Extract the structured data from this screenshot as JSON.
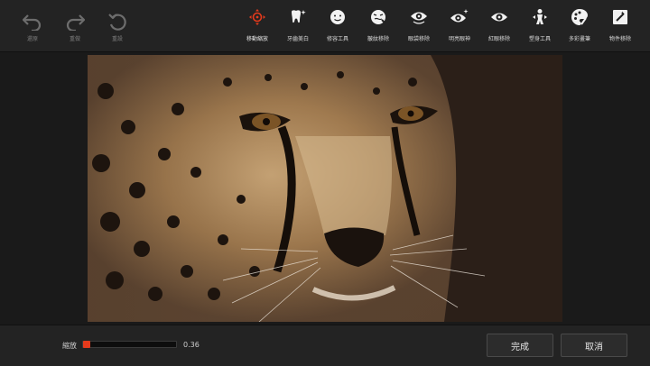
{
  "history": [
    {
      "name": "undo",
      "label": "還原",
      "icon": "undo-icon"
    },
    {
      "name": "redo",
      "label": "重做",
      "icon": "redo-icon"
    },
    {
      "name": "reset",
      "label": "重設",
      "icon": "reset-icon"
    }
  ],
  "tools": [
    {
      "label": "移動縮放",
      "icon": "move-zoom-icon",
      "active": true
    },
    {
      "label": "牙齒美白",
      "icon": "tooth-whitening-icon"
    },
    {
      "label": "修容工具",
      "icon": "face-contour-icon"
    },
    {
      "label": "皺紋移除",
      "icon": "wrinkle-removal-icon"
    },
    {
      "label": "眼袋移除",
      "icon": "eye-bag-removal-icon"
    },
    {
      "label": "明亮眼神",
      "icon": "bright-eyes-icon"
    },
    {
      "label": "紅眼移除",
      "icon": "red-eye-removal-icon"
    },
    {
      "label": "塑身工具",
      "icon": "body-slimming-icon"
    },
    {
      "label": "多彩畫筆",
      "icon": "color-brush-icon"
    },
    {
      "label": "物件移除",
      "icon": "object-removal-icon"
    }
  ],
  "zoom": {
    "label": "縮放",
    "value": "0.36",
    "fraction": 0.0
  },
  "buttons": {
    "done": "完成",
    "cancel": "取消"
  },
  "colors": {
    "accent": "#e43a1c",
    "background": "#1e1e1e",
    "toolbar": "#232323"
  }
}
